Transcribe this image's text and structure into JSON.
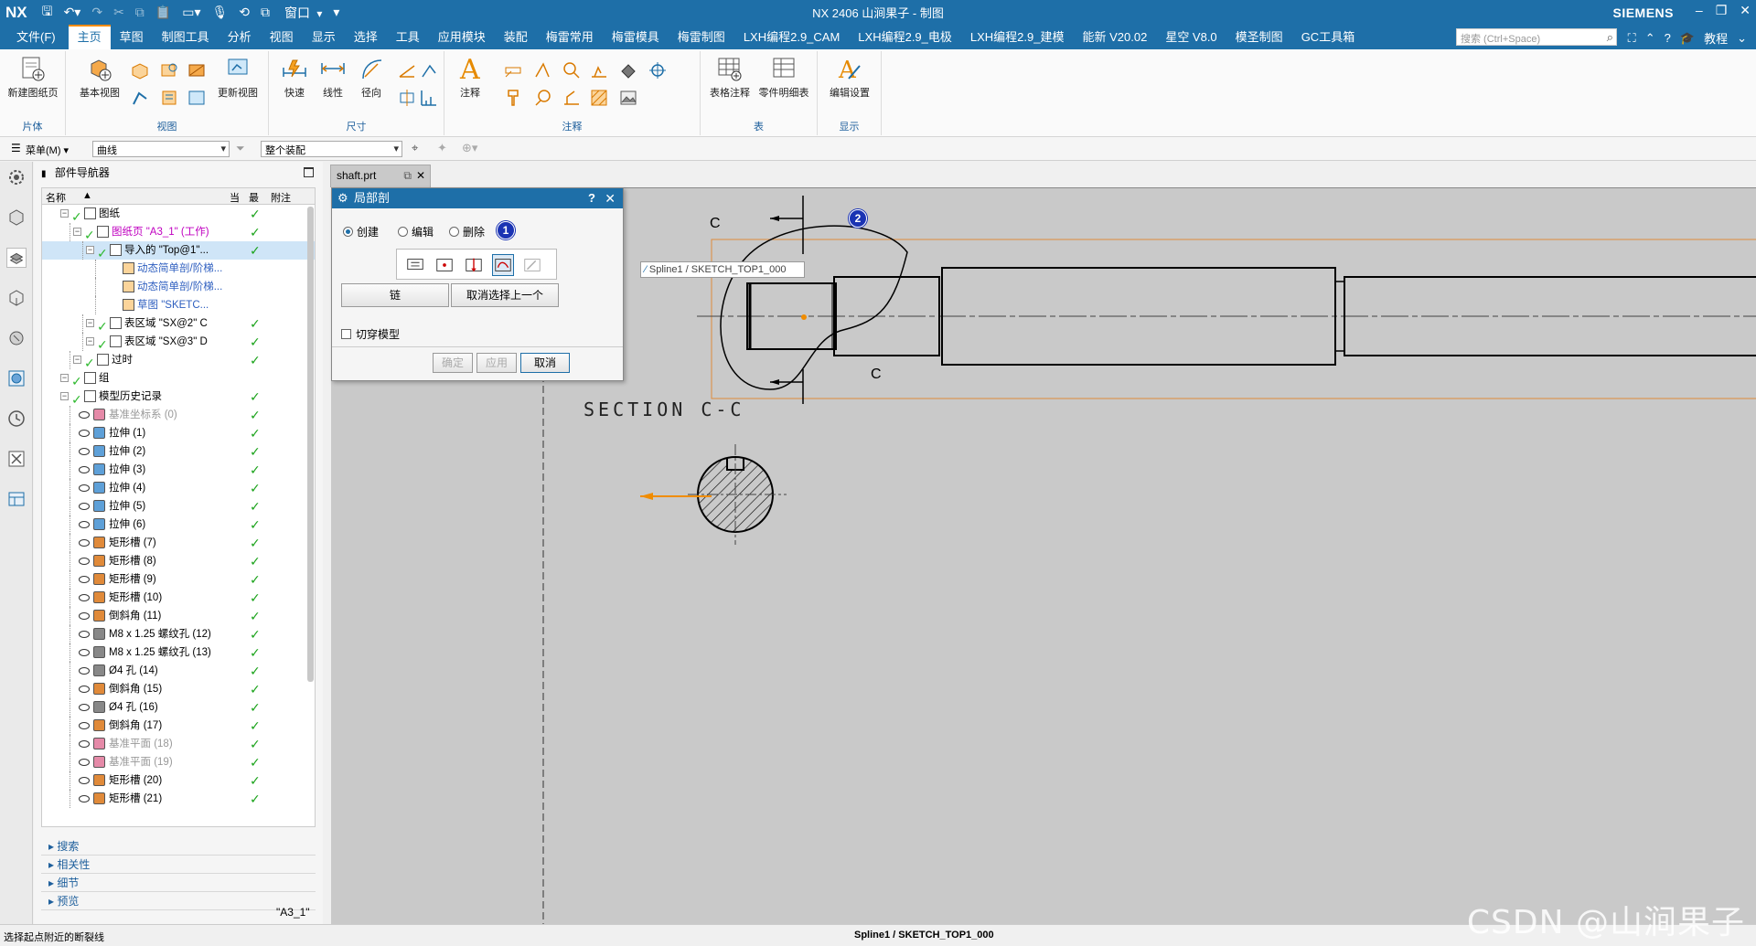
{
  "titlebar": {
    "logo": "NX",
    "window_label": "窗口",
    "title": "NX 2406 山涧果子 - 制图",
    "brand": "SIEMENS"
  },
  "menubar": {
    "file": "文件(F)",
    "items": [
      "主页",
      "草图",
      "制图工具",
      "分析",
      "视图",
      "显示",
      "选择",
      "工具",
      "应用模块",
      "装配",
      "梅雷常用",
      "梅雷模具",
      "梅雷制图",
      "LXH编程2.9_CAM",
      "LXH编程2.9_电极",
      "LXH编程2.9_建模",
      "能新 V20.02",
      "星空 V8.0",
      "模圣制图",
      "GC工具箱"
    ],
    "active_index": 0,
    "search_placeholder": "搜索 (Ctrl+Space)",
    "tutorial": "教程"
  },
  "ribbon": {
    "groups": {
      "sheet": "片体",
      "view": "视图",
      "dimension": "尺寸",
      "annotation": "注释",
      "table": "表",
      "display": "显示"
    },
    "buttons": {
      "new_sheet": "新建图纸页",
      "base_view": "基本视图",
      "update_view": "更新视图",
      "rapid": "快速",
      "linear": "线性",
      "radial": "径向",
      "note": "注释",
      "tabular_note": "表格注释",
      "parts_list": "零件明细表",
      "edit_settings": "编辑设置"
    }
  },
  "toolbar2": {
    "menu": "菜单(M)",
    "filter": "曲线",
    "scope": "整个装配"
  },
  "navigator": {
    "title": "部件导航器",
    "columns": {
      "name": "名称",
      "current": "当",
      "latest": "最",
      "comment": "附注"
    },
    "rows": [
      {
        "label": "图纸",
        "indent": 1,
        "cls": ""
      },
      {
        "label": "图纸页 \"A3_1\" (工作)",
        "indent": 2,
        "cls": "magenta"
      },
      {
        "label": "导入的 \"Top@1\"...",
        "indent": 3,
        "cls": "",
        "selected": true
      },
      {
        "label": "动态简单剖/阶梯...",
        "indent": 4,
        "cls": "bluet"
      },
      {
        "label": "动态简单剖/阶梯...",
        "indent": 4,
        "cls": "bluet"
      },
      {
        "label": "草图 \"SKETC...",
        "indent": 4,
        "cls": "bluet"
      },
      {
        "label": "表区域 \"SX@2\" C",
        "indent": 3,
        "cls": ""
      },
      {
        "label": "表区域 \"SX@3\" D",
        "indent": 3,
        "cls": ""
      },
      {
        "label": "过时",
        "indent": 2,
        "cls": ""
      },
      {
        "label": "组",
        "indent": 1,
        "cls": ""
      },
      {
        "label": "模型历史记录",
        "indent": 1,
        "cls": ""
      },
      {
        "label": "基准坐标系 (0)",
        "indent": 2,
        "cls": "grey"
      },
      {
        "label": "拉伸 (1)",
        "indent": 2,
        "cls": ""
      },
      {
        "label": "拉伸 (2)",
        "indent": 2,
        "cls": ""
      },
      {
        "label": "拉伸 (3)",
        "indent": 2,
        "cls": ""
      },
      {
        "label": "拉伸 (4)",
        "indent": 2,
        "cls": ""
      },
      {
        "label": "拉伸 (5)",
        "indent": 2,
        "cls": ""
      },
      {
        "label": "拉伸 (6)",
        "indent": 2,
        "cls": ""
      },
      {
        "label": "矩形槽 (7)",
        "indent": 2,
        "cls": ""
      },
      {
        "label": "矩形槽 (8)",
        "indent": 2,
        "cls": ""
      },
      {
        "label": "矩形槽 (9)",
        "indent": 2,
        "cls": ""
      },
      {
        "label": "矩形槽 (10)",
        "indent": 2,
        "cls": ""
      },
      {
        "label": "倒斜角 (11)",
        "indent": 2,
        "cls": ""
      },
      {
        "label": "M8 x 1.25 螺纹孔 (12)",
        "indent": 2,
        "cls": ""
      },
      {
        "label": "M8 x 1.25 螺纹孔 (13)",
        "indent": 2,
        "cls": ""
      },
      {
        "label": "Ø4 孔 (14)",
        "indent": 2,
        "cls": ""
      },
      {
        "label": "倒斜角 (15)",
        "indent": 2,
        "cls": ""
      },
      {
        "label": "Ø4 孔 (16)",
        "indent": 2,
        "cls": ""
      },
      {
        "label": "倒斜角 (17)",
        "indent": 2,
        "cls": ""
      },
      {
        "label": "基准平面 (18)",
        "indent": 2,
        "cls": "grey"
      },
      {
        "label": "基准平面 (19)",
        "indent": 2,
        "cls": "grey"
      },
      {
        "label": "矩形槽 (20)",
        "indent": 2,
        "cls": ""
      },
      {
        "label": "矩形槽 (21)",
        "indent": 2,
        "cls": ""
      }
    ],
    "sections": [
      "搜索",
      "相关性",
      "细节",
      "预览"
    ]
  },
  "document_tab": "shaft.prt",
  "dialog": {
    "title": "局部剖",
    "radio_create": "创建",
    "radio_edit": "编辑",
    "radio_delete": "删除",
    "btn_chain": "链",
    "btn_deselect": "取消选择上一个",
    "checkbox_cut": "切穿模型",
    "btn_ok": "确定",
    "btn_apply": "应用",
    "btn_cancel": "取消",
    "badge1": "1",
    "badge2": "2"
  },
  "drawing": {
    "spline_tooltip": "Spline1 / SKETCH_TOP1_000",
    "section_title": "SECTION  C-C",
    "label_c_top": "C",
    "label_c_bottom": "C",
    "sheet_name": "\"A3_1\""
  },
  "statusbar": {
    "prompt": "选择起点附近的断裂线",
    "selection": "Spline1 / SKETCH_TOP1_000"
  },
  "watermark": "CSDN @山涧果子"
}
